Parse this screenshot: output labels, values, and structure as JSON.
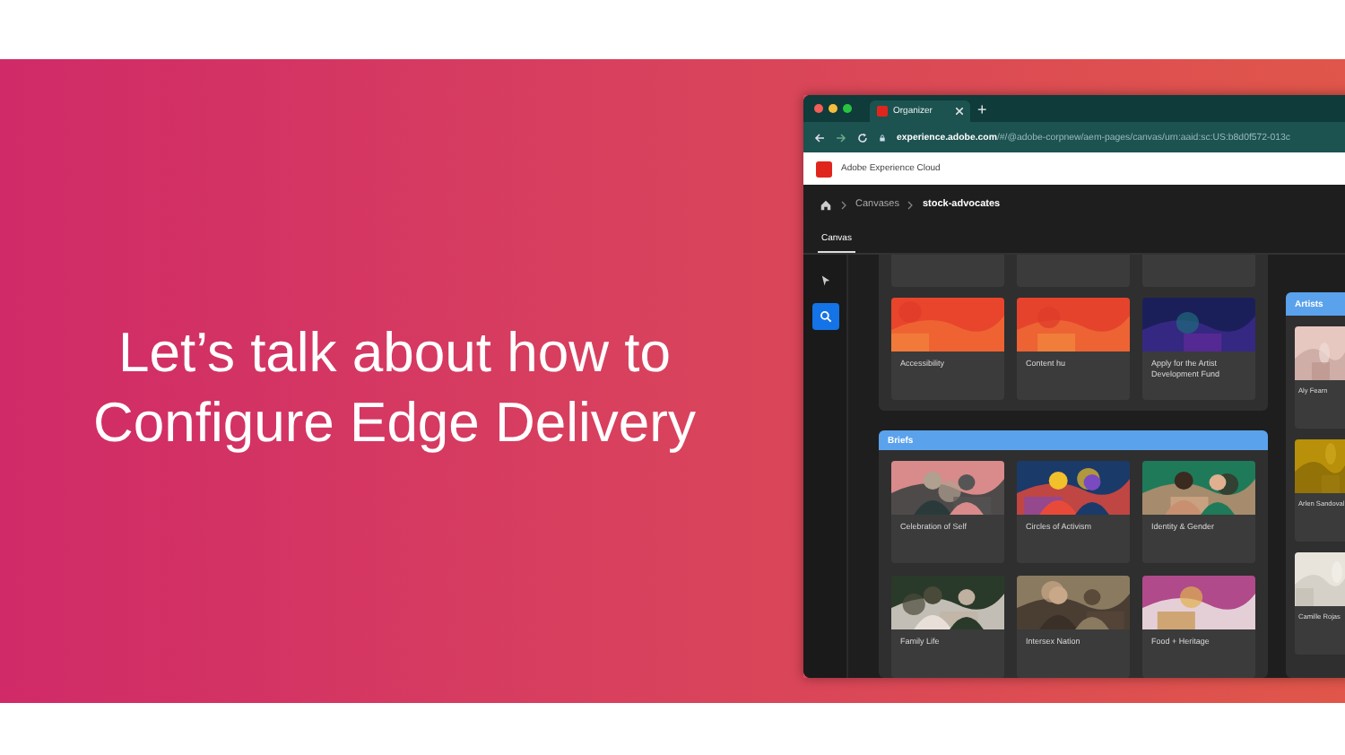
{
  "slide": {
    "heading": "Let’s talk about how to Configure Edge Delivery"
  },
  "browser": {
    "tab_title": "Organizer",
    "new_tab": "+",
    "url_host": "experience.adobe.com",
    "url_path": "/#/@adobe-corpnew/aem-pages/canvas/urn:aaid:sc:US:b8d0f572-013c",
    "app_title": "Adobe Experience Cloud",
    "breadcrumb": [
      "Canvases",
      "stock-advocates"
    ],
    "tabs": [
      {
        "label": "Canvas",
        "selected": true
      }
    ],
    "tools": [
      {
        "kind": "pointer",
        "selected": false
      },
      {
        "kind": "search",
        "selected": true
      }
    ],
    "top_cards": [
      {
        "title": "Accessibility"
      },
      {
        "title": "Content hu"
      },
      {
        "title": "Apply for the Artist Development Fund"
      }
    ],
    "briefs": {
      "title": "Briefs",
      "cards": [
        {
          "title": "Celebration of Self"
        },
        {
          "title": "Circles of Activism"
        },
        {
          "title": "Identity & Gender"
        },
        {
          "title": "Family Life"
        },
        {
          "title": "Intersex Nation"
        },
        {
          "title": "Food + Heritage"
        }
      ]
    },
    "artists": {
      "title": "Artists",
      "cards": [
        {
          "title": "Aly Fearn"
        },
        {
          "title": "Arlen Sandoval"
        },
        {
          "title": "Camille Rojas"
        }
      ]
    }
  }
}
